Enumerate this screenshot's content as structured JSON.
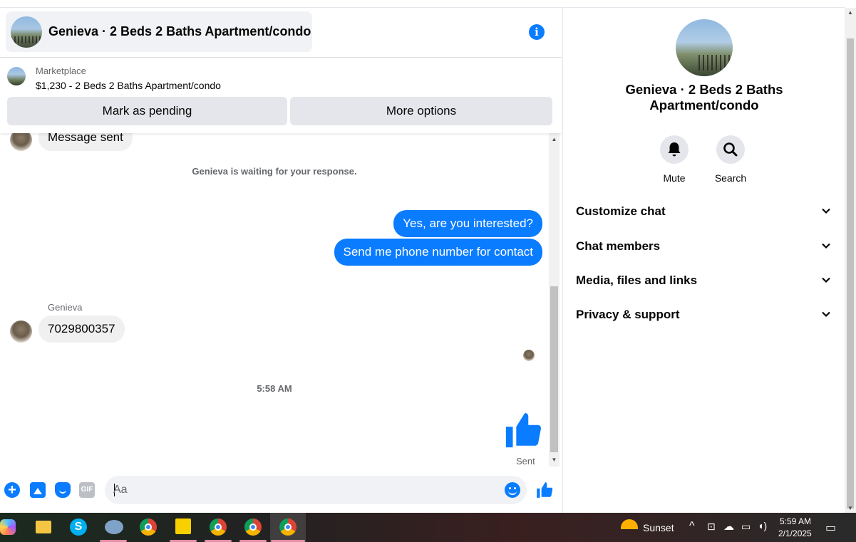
{
  "header": {
    "chat_title": "Genieva · 2 Beds 2 Baths Apartment/condo",
    "info_icon": "i"
  },
  "marketplace": {
    "label": "Marketplace",
    "listing": "$1,230 - 2 Beds 2 Baths Apartment/condo",
    "mark_pending": "Mark as pending",
    "more_options": "More options"
  },
  "messages": {
    "partial_top": "Message sent",
    "waiting": "Genieva is waiting for your response.",
    "out1": "Yes, are you interested?",
    "out2": "Send me phone number for contact",
    "sender": "Genieva",
    "in1": "7029800357",
    "time": "5:58 AM",
    "sent": "Sent"
  },
  "composer": {
    "gif": "GIF",
    "placeholder": "Aa"
  },
  "right_panel": {
    "title": "Genieva · 2 Beds 2 Baths Apartment/condo",
    "mute": "Mute",
    "search": "Search",
    "sections": [
      "Customize chat",
      "Chat members",
      "Media, files and links",
      "Privacy & support"
    ]
  },
  "taskbar": {
    "weather": "Sunset",
    "time": "5:59 AM",
    "date": "2/1/2025"
  },
  "colors": {
    "accent": "#0a7cff",
    "bubble_in": "#f0f0f0",
    "button_bg": "#e4e6eb"
  }
}
